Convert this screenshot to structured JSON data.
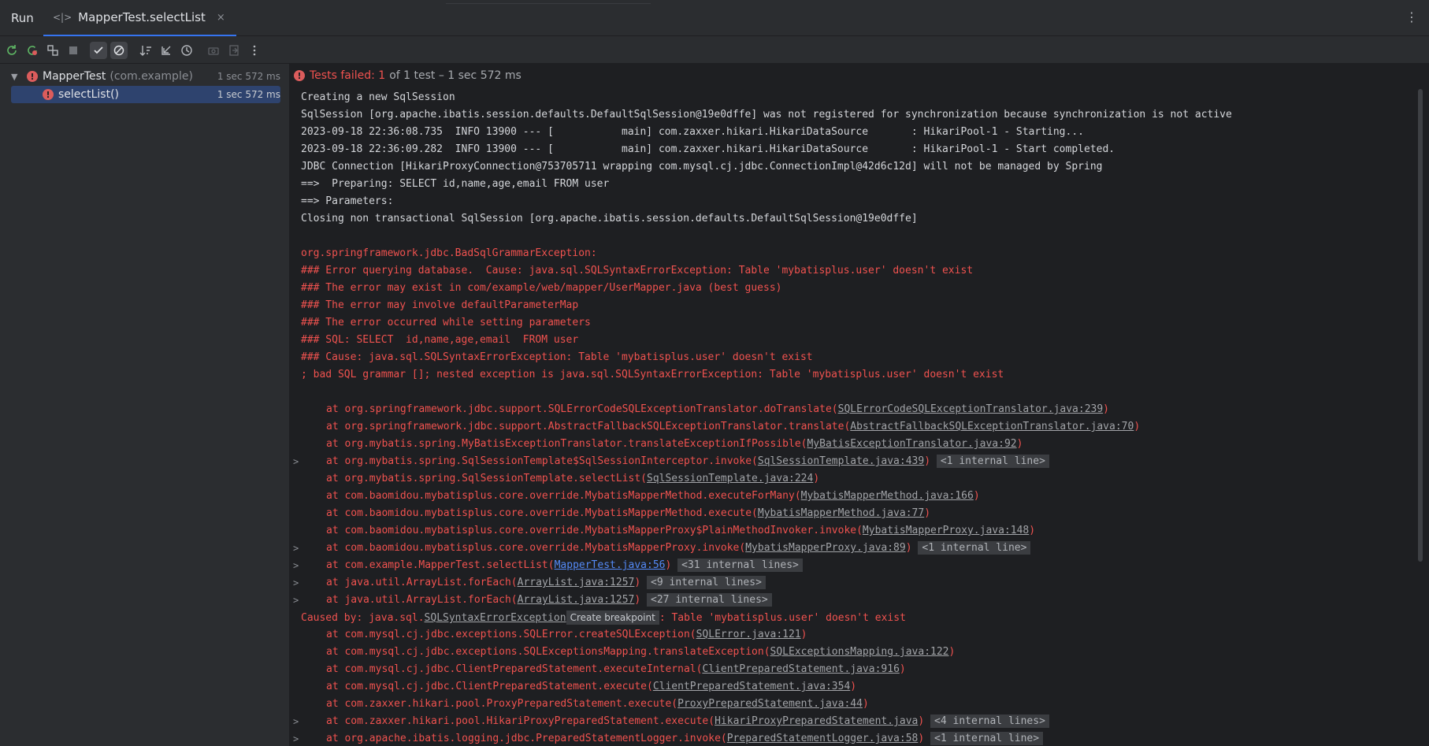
{
  "topbar": {
    "run_label": "Run",
    "tab_title": "MapperTest.selectList",
    "close_glyph": "×",
    "kebab_glyph": "⋮",
    "tab_icon": "<|>"
  },
  "toolbar": {
    "icons": [
      "rerun-icon",
      "rerun-failed-icon",
      "toggle-auto-test-icon",
      "stop-icon",
      "show-passed-icon",
      "show-ignored-icon",
      "sort-icon",
      "collapse-icon",
      "history-icon",
      "screenshot-icon",
      "export-icon",
      "more-icon"
    ]
  },
  "tree": {
    "root_label": "MapperTest",
    "root_pkg": "(com.example)",
    "root_time": "1 sec 572 ms",
    "child_label": "selectList()",
    "child_time": "1 sec 572 ms",
    "error_glyph": "!"
  },
  "status": {
    "failed_text": "Tests failed: 1",
    "summary_text": "of 1 test – 1 sec 572 ms"
  },
  "console": {
    "l1": "Creating a new SqlSession",
    "l2": "SqlSession [org.apache.ibatis.session.defaults.DefaultSqlSession@19e0dffe] was not registered for synchronization because synchronization is not active",
    "l3": "2023-09-18 22:36:08.735  INFO 13900 --- [           main] com.zaxxer.hikari.HikariDataSource       : HikariPool-1 - Starting...",
    "l4": "2023-09-18 22:36:09.282  INFO 13900 --- [           main] com.zaxxer.hikari.HikariDataSource       : HikariPool-1 - Start completed.",
    "l5": "JDBC Connection [HikariProxyConnection@753705711 wrapping com.mysql.cj.jdbc.ConnectionImpl@42d6c12d] will not be managed by Spring",
    "l6": "==>  Preparing: SELECT id,name,age,email FROM user",
    "l7": "==> Parameters: ",
    "l8": "Closing non transactional SqlSession [org.apache.ibatis.session.defaults.DefaultSqlSession@19e0dffe]",
    "e1": "org.springframework.jdbc.BadSqlGrammarException: ",
    "e2": "### Error querying database.  Cause: java.sql.SQLSyntaxErrorException: Table 'mybatisplus.user' doesn't exist",
    "e3": "### The error may exist in com/example/web/mapper/UserMapper.java (best guess)",
    "e4": "### The error may involve defaultParameterMap",
    "e5": "### The error occurred while setting parameters",
    "e6": "### SQL: SELECT  id,name,age,email  FROM user",
    "e7": "### Cause: java.sql.SQLSyntaxErrorException: Table 'mybatisplus.user' doesn't exist",
    "e8": "; bad SQL grammar []; nested exception is java.sql.SQLSyntaxErrorException: Table 'mybatisplus.user' doesn't exist",
    "s1a": "at org.springframework.jdbc.support.SQLErrorCodeSQLExceptionTranslator.doTranslate(",
    "s1b": "SQLErrorCodeSQLExceptionTranslator.java:239",
    "s1c": ")",
    "s2a": "at org.springframework.jdbc.support.AbstractFallbackSQLExceptionTranslator.translate(",
    "s2b": "AbstractFallbackSQLExceptionTranslator.java:70",
    "s2c": ")",
    "s3a": "at org.mybatis.spring.MyBatisExceptionTranslator.translateExceptionIfPossible(",
    "s3b": "MyBatisExceptionTranslator.java:92",
    "s3c": ")",
    "s4a": "at org.mybatis.spring.SqlSessionTemplate$SqlSessionInterceptor.invoke(",
    "s4b": "SqlSessionTemplate.java:439",
    "s4c": ")",
    "s4f": "<1 internal line>",
    "s5a": "at org.mybatis.spring.SqlSessionTemplate.selectList(",
    "s5b": "SqlSessionTemplate.java:224",
    "s5c": ")",
    "s6a": "at com.baomidou.mybatisplus.core.override.MybatisMapperMethod.executeForMany(",
    "s6b": "MybatisMapperMethod.java:166",
    "s6c": ")",
    "s7a": "at com.baomidou.mybatisplus.core.override.MybatisMapperMethod.execute(",
    "s7b": "MybatisMapperMethod.java:77",
    "s7c": ")",
    "s8a": "at com.baomidou.mybatisplus.core.override.MybatisMapperProxy$PlainMethodInvoker.invoke(",
    "s8b": "MybatisMapperProxy.java:148",
    "s8c": ")",
    "s9a": "at com.baomidou.mybatisplus.core.override.MybatisMapperProxy.invoke(",
    "s9b": "MybatisMapperProxy.java:89",
    "s9c": ")",
    "s9f": "<1 internal line>",
    "s10a": "at com.example.MapperTest.selectList(",
    "s10b": "MapperTest.java:56",
    "s10c": ")",
    "s10f": "<31 internal lines>",
    "s11a": "at java.util.ArrayList.forEach(",
    "s11b": "ArrayList.java:1257",
    "s11c": ")",
    "s11f": "<9 internal lines>",
    "s12a": "at java.util.ArrayList.forEach(",
    "s12b": "ArrayList.java:1257",
    "s12c": ")",
    "s12f": "<27 internal lines>",
    "c1a": "Caused by: java.sql.",
    "c1b": "SQLSyntaxErrorException",
    "c1tip": "Create breakpoint",
    "c1c": ": Table 'mybatisplus.user' doesn't exist",
    "t1a": "at com.mysql.cj.jdbc.exceptions.SQLError.createSQLException(",
    "t1b": "SQLError.java:121",
    "t1c": ")",
    "t2a": "at com.mysql.cj.jdbc.exceptions.SQLExceptionsMapping.translateException(",
    "t2b": "SQLExceptionsMapping.java:122",
    "t2c": ")",
    "t3a": "at com.mysql.cj.jdbc.ClientPreparedStatement.executeInternal(",
    "t3b": "ClientPreparedStatement.java:916",
    "t3c": ")",
    "t4a": "at com.mysql.cj.jdbc.ClientPreparedStatement.execute(",
    "t4b": "ClientPreparedStatement.java:354",
    "t4c": ")",
    "t5a": "at com.zaxxer.hikari.pool.ProxyPreparedStatement.execute(",
    "t5b": "ProxyPreparedStatement.java:44",
    "t5c": ")",
    "t6a": "at com.zaxxer.hikari.pool.HikariProxyPreparedStatement.execute(",
    "t6b": "HikariProxyPreparedStatement.java",
    "t6c": ")",
    "t6f": "<4 internal lines>",
    "t7a": "at org.apache.ibatis.logging.jdbc.PreparedStatementLogger.invoke(",
    "t7b": "PreparedStatementLogger.java:58",
    "t7c": ")",
    "t7f": "<1 internal line>",
    "gutter_glyph": ">"
  }
}
